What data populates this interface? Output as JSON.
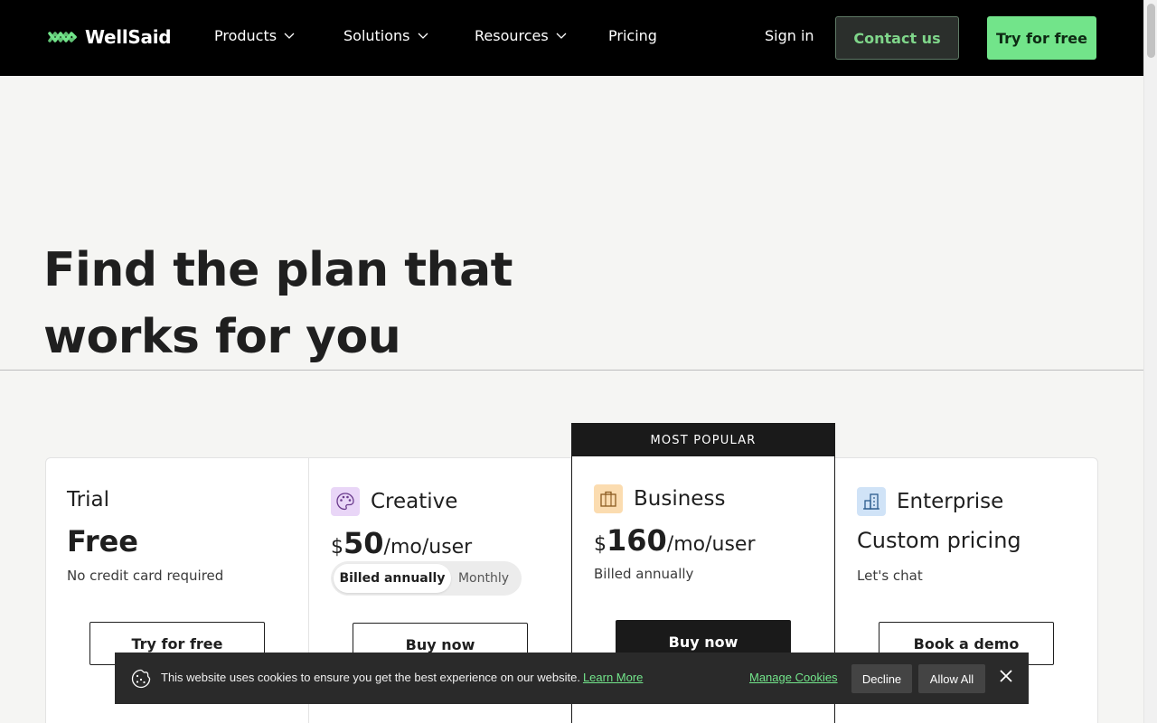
{
  "nav": {
    "brand": "WellSaid",
    "items": [
      {
        "label": "Products",
        "has_dropdown": true
      },
      {
        "label": "Solutions",
        "has_dropdown": true
      },
      {
        "label": "Resources",
        "has_dropdown": true
      },
      {
        "label": "Pricing",
        "has_dropdown": false
      }
    ],
    "sign_in": "Sign in",
    "contact": "Contact us",
    "try_free": "Try for free",
    "accent": "#72e48a"
  },
  "hero": {
    "title_line1": "Find the plan that",
    "title_line2": "works for you"
  },
  "plans": {
    "trial": {
      "name": "Trial",
      "price": "Free",
      "note": "No credit card required",
      "cta": "Try for free"
    },
    "creative": {
      "name": "Creative",
      "currency": "$",
      "amount": "50",
      "unit": "/mo/user",
      "toggle_active": "Billed annually",
      "toggle_inactive": "Monthly",
      "cta": "Buy now",
      "icon": "palette-icon",
      "icon_bg": "#e9d6f7"
    },
    "business": {
      "badge": "MOST POPULAR",
      "name": "Business",
      "currency": "$",
      "amount": "160",
      "unit": "/mo/user",
      "note": "Billed annually",
      "cta": "Buy now",
      "icon": "briefcase-icon",
      "icon_bg": "#fbdcb0"
    },
    "enterprise": {
      "name": "Enterprise",
      "price": "Custom pricing",
      "note": "Let's chat",
      "cta": "Book a demo",
      "icon": "building-icon",
      "icon_bg": "#d0e3f7"
    }
  },
  "cookie": {
    "text": "This website uses cookies to ensure you get the best experience on our website.",
    "learn_more": "Learn More",
    "manage": "Manage Cookies",
    "decline": "Decline",
    "allow": "Allow All"
  }
}
